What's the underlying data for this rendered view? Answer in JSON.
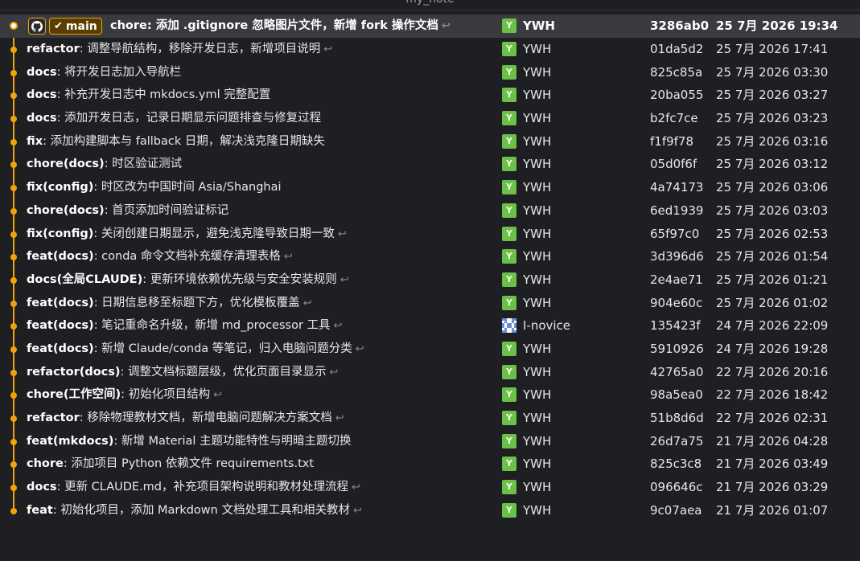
{
  "window": {
    "title": "my_note"
  },
  "head": {
    "branch": "main"
  },
  "colors": {
    "graph": "#f0a30a",
    "avatar_green": "#6cc04a",
    "background": "#1e1f22"
  },
  "commits": [
    {
      "type": "chore:",
      "msg": " 添加 .gitignore 忽略图片文件，新增 fork 操作文档",
      "ret": true,
      "author": "YWH",
      "sha": "3286ab0",
      "date": "25 7月 2026 19:34",
      "avatar": "Y"
    },
    {
      "type": "refactor",
      "msg": ": 调整导航结构，移除开发日志，新增项目说明",
      "ret": true,
      "author": "YWH",
      "sha": "01da5d2",
      "date": "25 7月 2026 17:41",
      "avatar": "Y"
    },
    {
      "type": "docs",
      "msg": ": 将开发日志加入导航栏",
      "ret": false,
      "author": "YWH",
      "sha": "825c85a",
      "date": "25 7月 2026 03:30",
      "avatar": "Y"
    },
    {
      "type": "docs",
      "msg": ": 补充开发日志中 mkdocs.yml 完整配置",
      "ret": false,
      "author": "YWH",
      "sha": "20ba055",
      "date": "25 7月 2026 03:27",
      "avatar": "Y"
    },
    {
      "type": "docs",
      "msg": ": 添加开发日志，记录日期显示问题排查与修复过程",
      "ret": false,
      "author": "YWH",
      "sha": "b2fc7ce",
      "date": "25 7月 2026 03:23",
      "avatar": "Y"
    },
    {
      "type": "fix",
      "msg": ": 添加构建脚本与 fallback 日期，解决浅克隆日期缺失",
      "ret": false,
      "author": "YWH",
      "sha": "f1f9f78",
      "date": "25 7月 2026 03:16",
      "avatar": "Y"
    },
    {
      "type": "chore(docs)",
      "msg": ": 时区验证测试",
      "ret": false,
      "author": "YWH",
      "sha": "05d0f6f",
      "date": "25 7月 2026 03:12",
      "avatar": "Y"
    },
    {
      "type": "fix(config)",
      "msg": ": 时区改为中国时间 Asia/Shanghai",
      "ret": false,
      "author": "YWH",
      "sha": "4a74173",
      "date": "25 7月 2026 03:06",
      "avatar": "Y"
    },
    {
      "type": "chore(docs)",
      "msg": ": 首页添加时间验证标记",
      "ret": false,
      "author": "YWH",
      "sha": "6ed1939",
      "date": "25 7月 2026 03:03",
      "avatar": "Y"
    },
    {
      "type": "fix(config)",
      "msg": ": 关闭创建日期显示，避免浅克隆导致日期一致",
      "ret": true,
      "author": "YWH",
      "sha": "65f97c0",
      "date": "25 7月 2026 02:53",
      "avatar": "Y"
    },
    {
      "type": "feat(docs)",
      "msg": ": conda 命令文档补充缓存清理表格",
      "ret": true,
      "author": "YWH",
      "sha": "3d396d6",
      "date": "25 7月 2026 01:54",
      "avatar": "Y"
    },
    {
      "type": "docs(全局CLAUDE)",
      "msg": ": 更新环境依赖优先级与安全安装规则",
      "ret": true,
      "author": "YWH",
      "sha": "2e4ae71",
      "date": "25 7月 2026 01:21",
      "avatar": "Y"
    },
    {
      "type": "feat(docs)",
      "msg": ": 日期信息移至标题下方，优化模板覆盖",
      "ret": true,
      "author": "YWH",
      "sha": "904e60c",
      "date": "25 7月 2026 01:02",
      "avatar": "Y"
    },
    {
      "type": "feat(docs)",
      "msg": ": 笔记重命名升级，新增 md_processor 工具",
      "ret": true,
      "author": "I-novice",
      "sha": "135423f",
      "date": "24 7月 2026 22:09",
      "avatar": "pixel"
    },
    {
      "type": "feat(docs)",
      "msg": ": 新增 Claude/conda 等笔记，归入电脑问题分类",
      "ret": true,
      "author": "YWH",
      "sha": "5910926",
      "date": "24 7月 2026 19:28",
      "avatar": "Y"
    },
    {
      "type": "refactor(docs)",
      "msg": ": 调整文档标题层级，优化页面目录显示",
      "ret": true,
      "author": "YWH",
      "sha": "42765a0",
      "date": "22 7月 2026 20:16",
      "avatar": "Y"
    },
    {
      "type": "chore(工作空间)",
      "msg": ": 初始化项目结构",
      "ret": true,
      "author": "YWH",
      "sha": "98a5ea0",
      "date": "22 7月 2026 18:42",
      "avatar": "Y"
    },
    {
      "type": "refactor",
      "msg": ": 移除物理教材文档，新增电脑问题解决方案文档",
      "ret": true,
      "author": "YWH",
      "sha": "51b8d6d",
      "date": "22 7月 2026 02:31",
      "avatar": "Y"
    },
    {
      "type": "feat(mkdocs)",
      "msg": ": 新增 Material 主题功能特性与明暗主题切换",
      "ret": false,
      "author": "YWH",
      "sha": "26d7a75",
      "date": "21 7月 2026 04:28",
      "avatar": "Y"
    },
    {
      "type": "chore",
      "msg": ": 添加项目 Python 依赖文件 requirements.txt",
      "ret": false,
      "author": "YWH",
      "sha": "825c3c8",
      "date": "21 7月 2026 03:49",
      "avatar": "Y"
    },
    {
      "type": "docs",
      "msg": ": 更新 CLAUDE.md，补充项目架构说明和教材处理流程",
      "ret": true,
      "author": "YWH",
      "sha": "096646c",
      "date": "21 7月 2026 03:29",
      "avatar": "Y"
    },
    {
      "type": "feat",
      "msg": ": 初始化项目，添加 Markdown 文档处理工具和相关教材",
      "ret": true,
      "author": "YWH",
      "sha": "9c07aea",
      "date": "21 7月 2026 01:07",
      "avatar": "Y"
    }
  ]
}
